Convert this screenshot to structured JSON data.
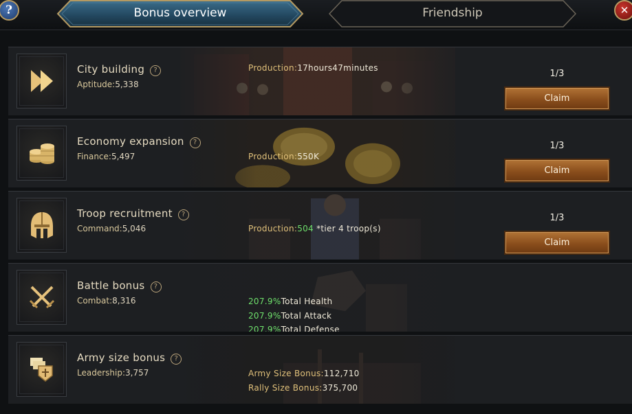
{
  "tabs": {
    "active_label": "Bonus overview",
    "inactive_label": "Friendship"
  },
  "top_buttons": {
    "help_glyph": "?",
    "close_glyph": "✕"
  },
  "colors": {
    "accent_gold": "#d9c89c",
    "green_value": "#6fe06c",
    "claim_button": "#8a4e1c"
  },
  "rows": [
    {
      "title": "City building",
      "stat_label": "Aptitude:",
      "stat_value": "5,338",
      "icon": "fast-forward-icon",
      "production_label": "Production:",
      "production_value": "17hours47minutes",
      "count": "1/3",
      "claim_label": "Claim"
    },
    {
      "title": "Economy expansion",
      "stat_label": "Finance:",
      "stat_value": "5,497",
      "icon": "coins-icon",
      "production_label": "Production:",
      "production_value": "550K",
      "count": "1/3",
      "claim_label": "Claim"
    },
    {
      "title": "Troop recruitment",
      "stat_label": "Command:",
      "stat_value": "5,046",
      "icon": "helmet-icon",
      "production_label": "Production:",
      "production_value": "504",
      "production_suffix": " *tier 4 troop(s)",
      "count": "1/3",
      "claim_label": "Claim"
    },
    {
      "title": "Battle bonus",
      "stat_label": "Combat:",
      "stat_value": "8,316",
      "icon": "crossed-swords-icon",
      "bonuses": [
        {
          "value": "207.9%",
          "label": "Total Health"
        },
        {
          "value": "207.9%",
          "label": "Total Attack"
        },
        {
          "value": "207.9%",
          "label": "Total Defense"
        }
      ]
    },
    {
      "title": "Army size bonus",
      "stat_label": "Leadership:",
      "stat_value": "3,757",
      "icon": "banner-shield-icon",
      "army_label": "Army Size Bonus:",
      "army_value": "112,710",
      "rally_label": "Rally Size Bonus:",
      "rally_value": "375,700"
    }
  ]
}
